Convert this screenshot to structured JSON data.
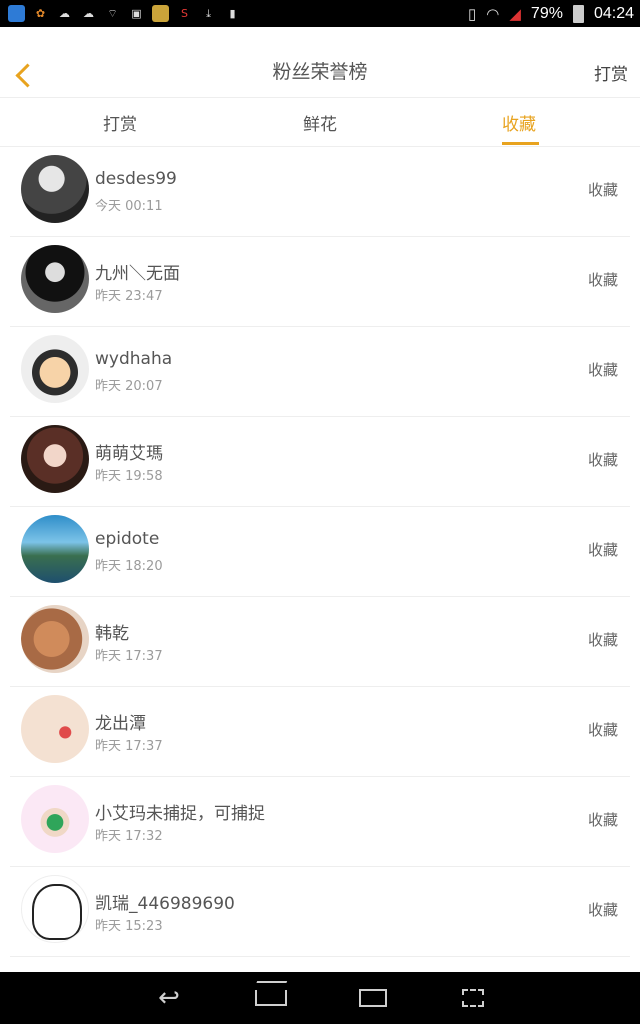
{
  "status_bar": {
    "battery": "79%",
    "time": "04:24",
    "icons_left": [
      "app-icon",
      "squirrel-icon",
      "cloud-icon",
      "cloud-icon",
      "signal-icon",
      "image-icon",
      "app-icon",
      "app-icon",
      "download-icon",
      "lock-icon"
    ]
  },
  "header": {
    "title": "粉丝荣誉榜",
    "right_link": "打赏"
  },
  "tabs": [
    {
      "label": "打赏"
    },
    {
      "label": "鲜花"
    },
    {
      "label": "收藏",
      "active": true
    }
  ],
  "items": [
    {
      "name": "desdes99",
      "time": "今天 00:11",
      "action": "收藏"
    },
    {
      "name": "九州＼无面",
      "time": "昨天 23:47",
      "action": "收藏"
    },
    {
      "name": "wydhaha",
      "time": "昨天 20:07",
      "action": "收藏"
    },
    {
      "name": "萌萌艾瑪",
      "time": "昨天 19:58",
      "action": "收藏"
    },
    {
      "name": "epidote",
      "time": "昨天 18:20",
      "action": "收藏"
    },
    {
      "name": "韩乾",
      "time": "昨天 17:37",
      "action": "收藏"
    },
    {
      "name": "龙出潭",
      "time": "昨天 17:37",
      "action": "收藏"
    },
    {
      "name": "小艾玛未捕捉，可捕捉",
      "time": "昨天 17:32",
      "action": "收藏"
    },
    {
      "name": "凯瑞_446989690",
      "time": "昨天 15:23",
      "action": "收藏"
    }
  ],
  "colors": {
    "accent": "#e8a31f",
    "text_primary": "#555555",
    "text_secondary": "#9b9b9b"
  }
}
